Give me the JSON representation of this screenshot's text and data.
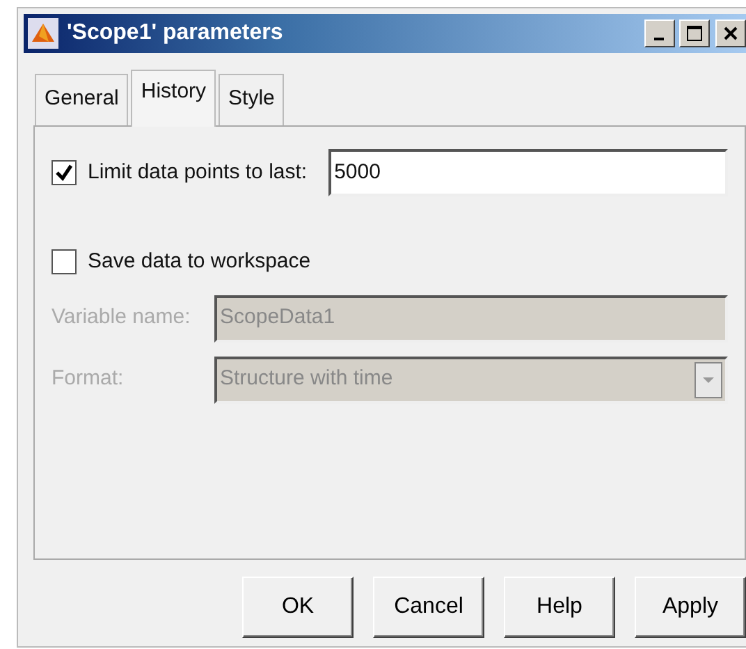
{
  "window": {
    "title": "'Scope1' parameters"
  },
  "tabs": [
    {
      "label": "General",
      "selected": false
    },
    {
      "label": "History",
      "selected": true
    },
    {
      "label": "Style",
      "selected": false
    }
  ],
  "limit": {
    "label": "Limit data points to last:",
    "checked": true,
    "value": "5000"
  },
  "save": {
    "label": "Save data to workspace",
    "checked": false
  },
  "variable": {
    "label": "Variable name:",
    "value": "ScopeData1",
    "disabled": true
  },
  "format": {
    "label": "Format:",
    "value": "Structure with time",
    "disabled": true
  },
  "buttons": [
    "OK",
    "Cancel",
    "Help",
    "Apply"
  ]
}
